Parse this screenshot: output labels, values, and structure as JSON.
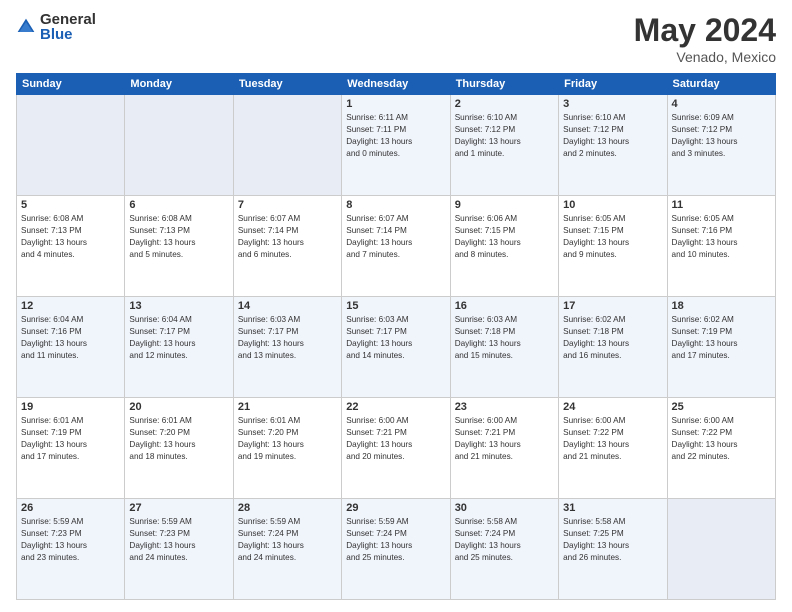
{
  "logo": {
    "general": "General",
    "blue": "Blue"
  },
  "title": {
    "month": "May 2024",
    "location": "Venado, Mexico"
  },
  "weekdays": [
    "Sunday",
    "Monday",
    "Tuesday",
    "Wednesday",
    "Thursday",
    "Friday",
    "Saturday"
  ],
  "weeks": [
    [
      {
        "day": "",
        "info": ""
      },
      {
        "day": "",
        "info": ""
      },
      {
        "day": "",
        "info": ""
      },
      {
        "day": "1",
        "info": "Sunrise: 6:11 AM\nSunset: 7:11 PM\nDaylight: 13 hours\nand 0 minutes."
      },
      {
        "day": "2",
        "info": "Sunrise: 6:10 AM\nSunset: 7:12 PM\nDaylight: 13 hours\nand 1 minute."
      },
      {
        "day": "3",
        "info": "Sunrise: 6:10 AM\nSunset: 7:12 PM\nDaylight: 13 hours\nand 2 minutes."
      },
      {
        "day": "4",
        "info": "Sunrise: 6:09 AM\nSunset: 7:12 PM\nDaylight: 13 hours\nand 3 minutes."
      }
    ],
    [
      {
        "day": "5",
        "info": "Sunrise: 6:08 AM\nSunset: 7:13 PM\nDaylight: 13 hours\nand 4 minutes."
      },
      {
        "day": "6",
        "info": "Sunrise: 6:08 AM\nSunset: 7:13 PM\nDaylight: 13 hours\nand 5 minutes."
      },
      {
        "day": "7",
        "info": "Sunrise: 6:07 AM\nSunset: 7:14 PM\nDaylight: 13 hours\nand 6 minutes."
      },
      {
        "day": "8",
        "info": "Sunrise: 6:07 AM\nSunset: 7:14 PM\nDaylight: 13 hours\nand 7 minutes."
      },
      {
        "day": "9",
        "info": "Sunrise: 6:06 AM\nSunset: 7:15 PM\nDaylight: 13 hours\nand 8 minutes."
      },
      {
        "day": "10",
        "info": "Sunrise: 6:05 AM\nSunset: 7:15 PM\nDaylight: 13 hours\nand 9 minutes."
      },
      {
        "day": "11",
        "info": "Sunrise: 6:05 AM\nSunset: 7:16 PM\nDaylight: 13 hours\nand 10 minutes."
      }
    ],
    [
      {
        "day": "12",
        "info": "Sunrise: 6:04 AM\nSunset: 7:16 PM\nDaylight: 13 hours\nand 11 minutes."
      },
      {
        "day": "13",
        "info": "Sunrise: 6:04 AM\nSunset: 7:17 PM\nDaylight: 13 hours\nand 12 minutes."
      },
      {
        "day": "14",
        "info": "Sunrise: 6:03 AM\nSunset: 7:17 PM\nDaylight: 13 hours\nand 13 minutes."
      },
      {
        "day": "15",
        "info": "Sunrise: 6:03 AM\nSunset: 7:17 PM\nDaylight: 13 hours\nand 14 minutes."
      },
      {
        "day": "16",
        "info": "Sunrise: 6:03 AM\nSunset: 7:18 PM\nDaylight: 13 hours\nand 15 minutes."
      },
      {
        "day": "17",
        "info": "Sunrise: 6:02 AM\nSunset: 7:18 PM\nDaylight: 13 hours\nand 16 minutes."
      },
      {
        "day": "18",
        "info": "Sunrise: 6:02 AM\nSunset: 7:19 PM\nDaylight: 13 hours\nand 17 minutes."
      }
    ],
    [
      {
        "day": "19",
        "info": "Sunrise: 6:01 AM\nSunset: 7:19 PM\nDaylight: 13 hours\nand 17 minutes."
      },
      {
        "day": "20",
        "info": "Sunrise: 6:01 AM\nSunset: 7:20 PM\nDaylight: 13 hours\nand 18 minutes."
      },
      {
        "day": "21",
        "info": "Sunrise: 6:01 AM\nSunset: 7:20 PM\nDaylight: 13 hours\nand 19 minutes."
      },
      {
        "day": "22",
        "info": "Sunrise: 6:00 AM\nSunset: 7:21 PM\nDaylight: 13 hours\nand 20 minutes."
      },
      {
        "day": "23",
        "info": "Sunrise: 6:00 AM\nSunset: 7:21 PM\nDaylight: 13 hours\nand 21 minutes."
      },
      {
        "day": "24",
        "info": "Sunrise: 6:00 AM\nSunset: 7:22 PM\nDaylight: 13 hours\nand 21 minutes."
      },
      {
        "day": "25",
        "info": "Sunrise: 6:00 AM\nSunset: 7:22 PM\nDaylight: 13 hours\nand 22 minutes."
      }
    ],
    [
      {
        "day": "26",
        "info": "Sunrise: 5:59 AM\nSunset: 7:23 PM\nDaylight: 13 hours\nand 23 minutes."
      },
      {
        "day": "27",
        "info": "Sunrise: 5:59 AM\nSunset: 7:23 PM\nDaylight: 13 hours\nand 24 minutes."
      },
      {
        "day": "28",
        "info": "Sunrise: 5:59 AM\nSunset: 7:24 PM\nDaylight: 13 hours\nand 24 minutes."
      },
      {
        "day": "29",
        "info": "Sunrise: 5:59 AM\nSunset: 7:24 PM\nDaylight: 13 hours\nand 25 minutes."
      },
      {
        "day": "30",
        "info": "Sunrise: 5:58 AM\nSunset: 7:24 PM\nDaylight: 13 hours\nand 25 minutes."
      },
      {
        "day": "31",
        "info": "Sunrise: 5:58 AM\nSunset: 7:25 PM\nDaylight: 13 hours\nand 26 minutes."
      },
      {
        "day": "",
        "info": ""
      }
    ]
  ]
}
